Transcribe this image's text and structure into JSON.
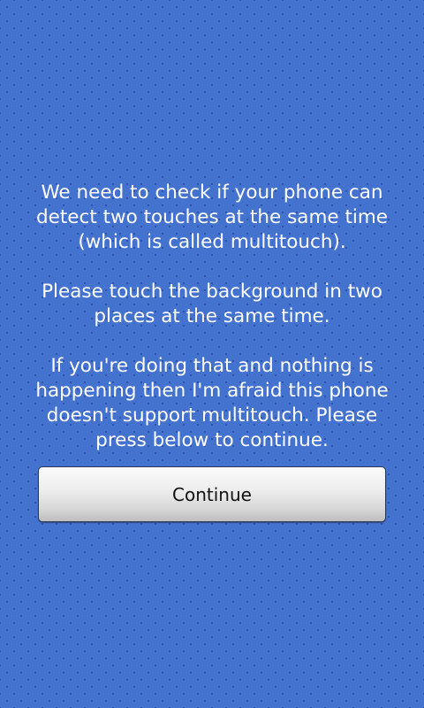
{
  "instructions": {
    "paragraph_1": "We need to check if your phone can detect two touches at the same time (which is called multitouch).",
    "paragraph_2": "Please touch the background in two places at the same time.",
    "paragraph_3": "If you're doing that and nothing is happening then I'm afraid this phone doesn't support multitouch. Please press below to continue."
  },
  "continue_button": {
    "label": "Continue"
  },
  "colors": {
    "background": "#4472cf",
    "text": "#ffffff"
  }
}
